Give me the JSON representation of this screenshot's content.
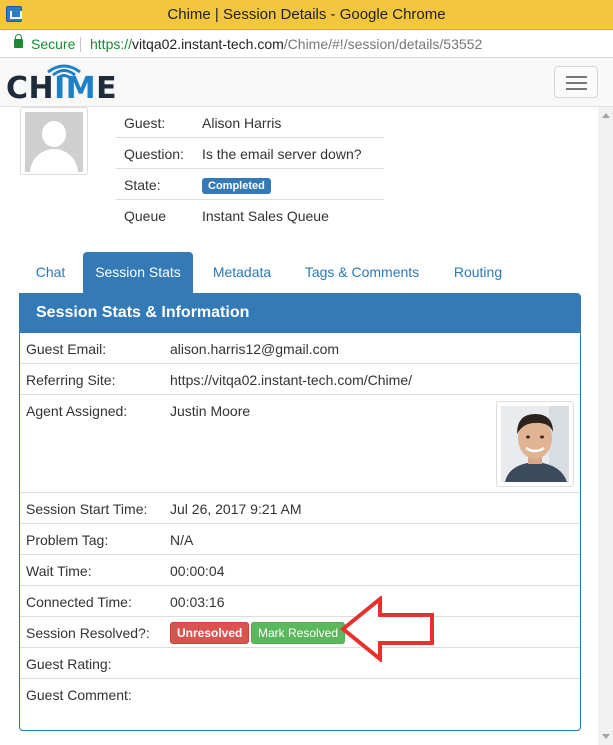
{
  "window": {
    "title": "Chime | Session Details - Google Chrome"
  },
  "address_bar": {
    "secure_label": "Secure",
    "url_scheme": "https://",
    "url_host": "vitqa02.instant-tech.com",
    "url_path": "/Chime/#!/session/details/53552"
  },
  "header": {
    "logo_dark": "CH",
    "logo_blue": "IM",
    "logo_dark2": "E"
  },
  "session": {
    "guest_label": "Guest:",
    "guest_value": "Alison Harris",
    "question_label": "Question:",
    "question_value": "Is the email server down?",
    "state_label": "State:",
    "state_value": "Completed",
    "queue_label": "Queue",
    "queue_value": "Instant Sales Queue"
  },
  "tabs": [
    {
      "label": "Chat",
      "active": false
    },
    {
      "label": "Session Stats",
      "active": true
    },
    {
      "label": "Metadata",
      "active": false
    },
    {
      "label": "Tags & Comments",
      "active": false
    },
    {
      "label": "Routing",
      "active": false
    }
  ],
  "panel": {
    "title": "Session Stats & Information",
    "rows": [
      {
        "label": "Guest Email:",
        "value": "alison.harris12@gmail.com"
      },
      {
        "label": "Referring Site:",
        "value": "https://vitqa02.instant-tech.com/Chime/"
      },
      {
        "label": "Agent Assigned:",
        "value": "Justin Moore"
      },
      {
        "label": "Session Start Time:",
        "value": "Jul 26, 2017 9:21 AM"
      },
      {
        "label": "Problem Tag:",
        "value": "N/A"
      },
      {
        "label": "Wait Time:",
        "value": "00:00:04"
      },
      {
        "label": "Connected Time:",
        "value": "00:03:16"
      },
      {
        "label": "Session Resolved?:",
        "value": ""
      },
      {
        "label": "Guest Rating:",
        "value": ""
      },
      {
        "label": "Guest Comment:",
        "value": ""
      }
    ],
    "unresolved_label": "Unresolved",
    "mark_resolved_label": "Mark Resolved"
  },
  "colors": {
    "titlebar": "#f3c63f",
    "primary": "#337ab7",
    "danger": "#d9534f",
    "success": "#5cb85c",
    "annotation_arrow": "#e8312f"
  }
}
